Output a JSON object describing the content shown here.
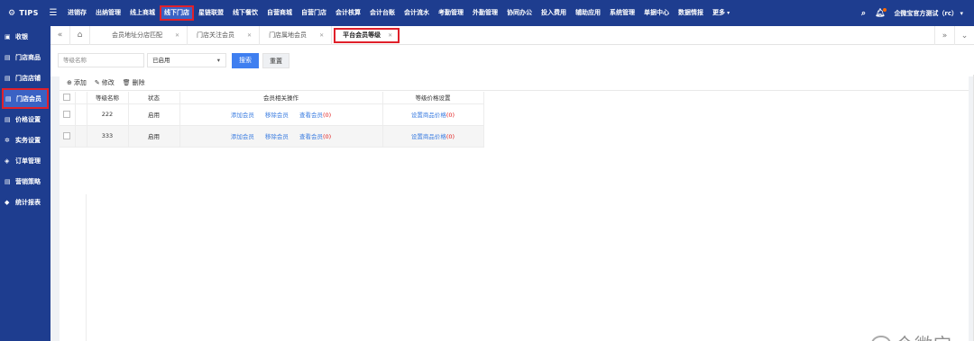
{
  "app": {
    "logo": "TIPS"
  },
  "nav": {
    "items": [
      "进销存",
      "出纳管理",
      "线上商城",
      "线下门店",
      "星链联盟",
      "线下餐饮",
      "自营商城",
      "自营门店",
      "会计核算",
      "会计台账",
      "会计流水",
      "考勤管理",
      "外勤管理",
      "协同办公",
      "投入费用",
      "辅助应用",
      "系统管理",
      "单据中心",
      "数据情报",
      "更多"
    ],
    "active": "线下门店",
    "company": "企微宝官方测试（rc）"
  },
  "sidebar": {
    "items": [
      "收银",
      "门店商品",
      "门店店铺",
      "门店会员",
      "价格设置",
      "实务设置",
      "订单管理",
      "营销策略",
      "统计报表"
    ],
    "active": "门店会员"
  },
  "tabs": {
    "items": [
      "会员地址分店匹配",
      "门店关注会员",
      "门店属地会员",
      "平台会员等级"
    ],
    "active": "平台会员等级"
  },
  "filter": {
    "name_placeholder": "等级名称",
    "status_value": "已启用",
    "search_label": "搜索",
    "reset_label": "重置"
  },
  "toolbar": {
    "add": "添加",
    "edit": "修改",
    "delete": "删除"
  },
  "table": {
    "headers": {
      "name": "等级名称",
      "status": "状态",
      "member_ops": "会员相关操作",
      "price": "等级价格设置"
    },
    "rows": [
      {
        "name": "222",
        "status": "启用",
        "add": "添加会员",
        "remove": "移除会员",
        "view": "查看会员",
        "view_count": "(0)",
        "price": "设置商品价格",
        "price_count": "(0)"
      },
      {
        "name": "333",
        "status": "启用",
        "add": "添加会员",
        "remove": "移除会员",
        "view": "查看会员",
        "view_count": "(0)",
        "price": "设置商品价格",
        "price_count": "(0)"
      }
    ]
  },
  "watermark": "企微宝"
}
